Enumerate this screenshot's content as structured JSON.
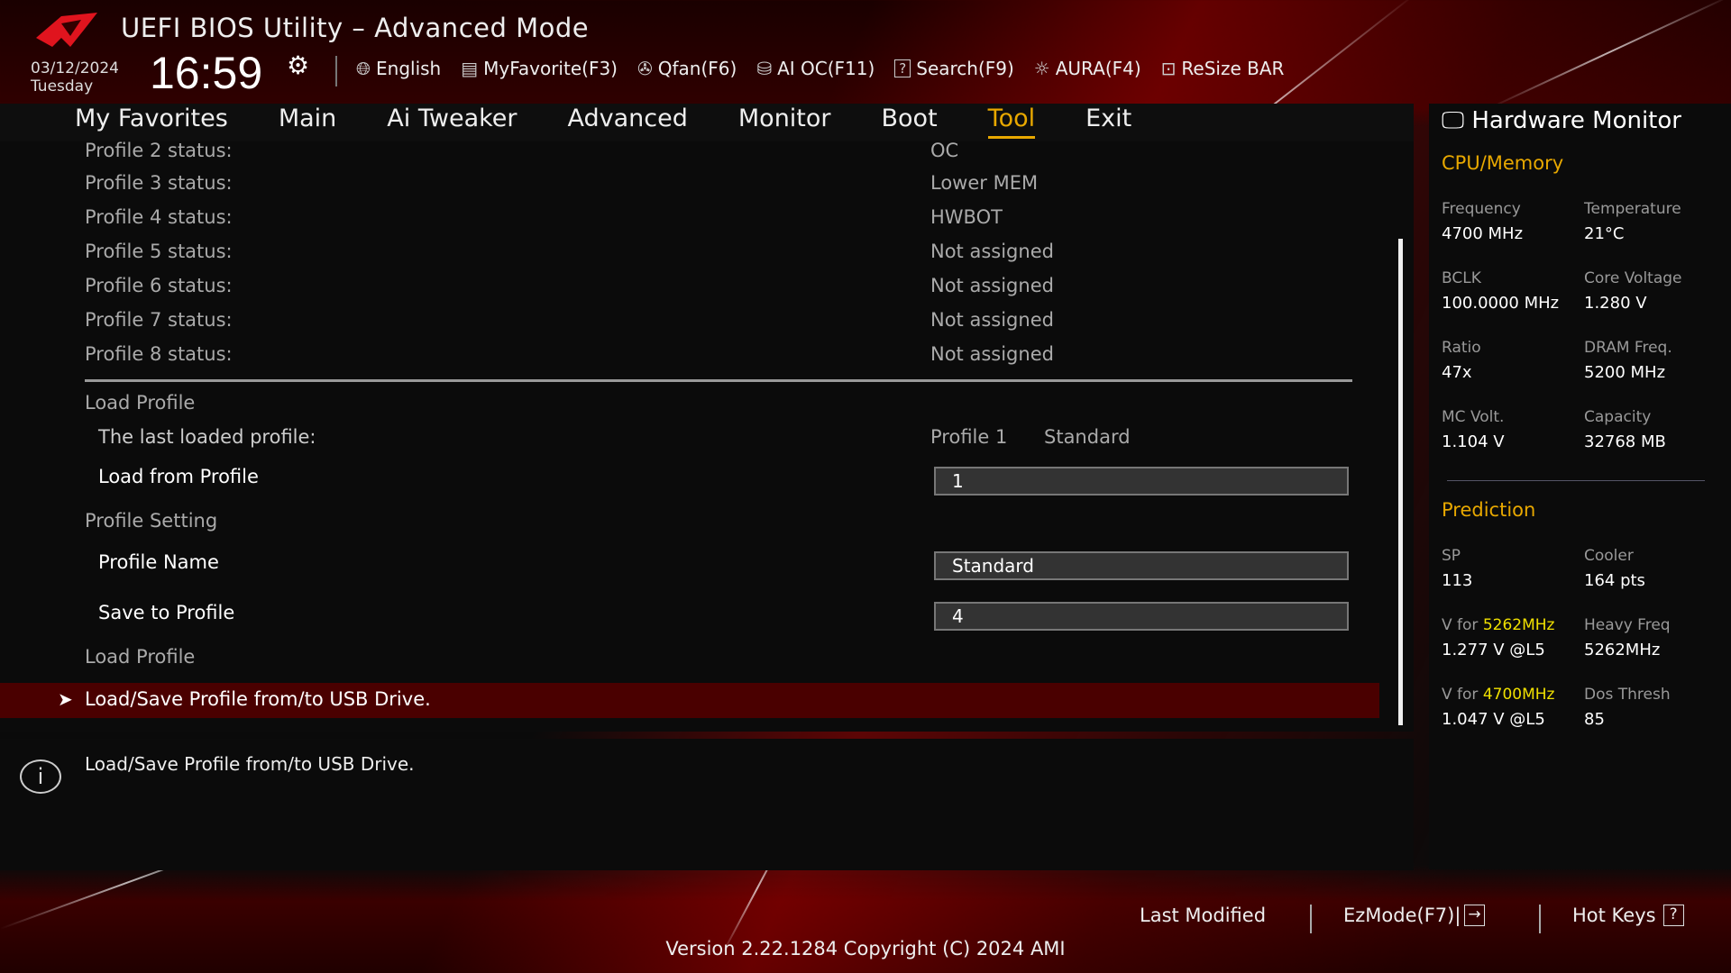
{
  "header": {
    "title": "UEFI BIOS Utility – Advanced Mode",
    "date": "03/12/2024",
    "day": "Tuesday",
    "time": "16:59",
    "tools": [
      {
        "icon": "globe-icon",
        "label": "English"
      },
      {
        "icon": "myfavorite-icon",
        "label": "MyFavorite(F3)"
      },
      {
        "icon": "fan-icon",
        "label": "Qfan(F6)"
      },
      {
        "icon": "ai-oc-icon",
        "label": "AI OC(F11)"
      },
      {
        "icon": "search-icon",
        "label": "Search(F9)"
      },
      {
        "icon": "aura-icon",
        "label": "AURA(F4)"
      },
      {
        "icon": "resize-bar-icon",
        "label": "ReSize BAR"
      }
    ]
  },
  "tabs": [
    "My Favorites",
    "Main",
    "Ai Tweaker",
    "Advanced",
    "Monitor",
    "Boot",
    "Tool",
    "Exit"
  ],
  "active_tab": "Tool",
  "main": {
    "statuses": [
      {
        "label": "Profile 2 status:",
        "value": "OC"
      },
      {
        "label": "Profile 3 status:",
        "value": "Lower MEM"
      },
      {
        "label": "Profile 4 status:",
        "value": "HWBOT"
      },
      {
        "label": "Profile 5 status:",
        "value": "Not assigned"
      },
      {
        "label": "Profile 6 status:",
        "value": "Not assigned"
      },
      {
        "label": "Profile 7 status:",
        "value": "Not assigned"
      },
      {
        "label": "Profile 8 status:",
        "value": "Not assigned"
      }
    ],
    "load_profile_header": "Load Profile",
    "last_loaded_label": "The last loaded profile:",
    "last_loaded_value": "Profile 1",
    "last_loaded_name": "Standard",
    "load_from_label": "Load from Profile",
    "load_from_value": "1",
    "profile_setting_header": "Profile Setting",
    "profile_name_label": "Profile Name",
    "profile_name_value": "Standard",
    "save_to_label": "Save to Profile",
    "save_to_value": "4",
    "load_profile_header2": "Load Profile",
    "usb_item": "Load/Save Profile from/to USB Drive."
  },
  "help": {
    "text": "Load/Save Profile from/to USB Drive."
  },
  "hw": {
    "title": "Hardware Monitor",
    "cpu_title": "CPU/Memory",
    "cpu": [
      {
        "label": "Frequency",
        "value": "4700 MHz"
      },
      {
        "label": "Temperature",
        "value": "21°C"
      },
      {
        "label": "BCLK",
        "value": "100.0000 MHz"
      },
      {
        "label": "Core Voltage",
        "value": "1.280 V"
      },
      {
        "label": "Ratio",
        "value": "47x"
      },
      {
        "label": "DRAM Freq.",
        "value": "5200 MHz"
      },
      {
        "label": "MC Volt.",
        "value": "1.104 V"
      },
      {
        "label": "Capacity",
        "value": "32768 MB"
      }
    ],
    "pred_title": "Prediction",
    "sp_label": "SP",
    "sp_value": "113",
    "cooler_label": "Cooler",
    "cooler_value": "164 pts",
    "v1_prefix": "V for ",
    "v1_freq": "5262MHz",
    "v1_value": "1.277 V @L5",
    "heavy_label": "Heavy Freq",
    "heavy_value": "5262MHz",
    "v2_prefix": "V for ",
    "v2_freq": "4700MHz",
    "v2_value": "1.047 V @L5",
    "dos_label": "Dos Thresh",
    "dos_value": "85"
  },
  "footer": {
    "last_modified": "Last Modified",
    "ezmode": "EzMode(F7)|",
    "hotkeys": "Hot Keys",
    "version": "Version 2.22.1284 Copyright (C) 2024 AMI"
  }
}
